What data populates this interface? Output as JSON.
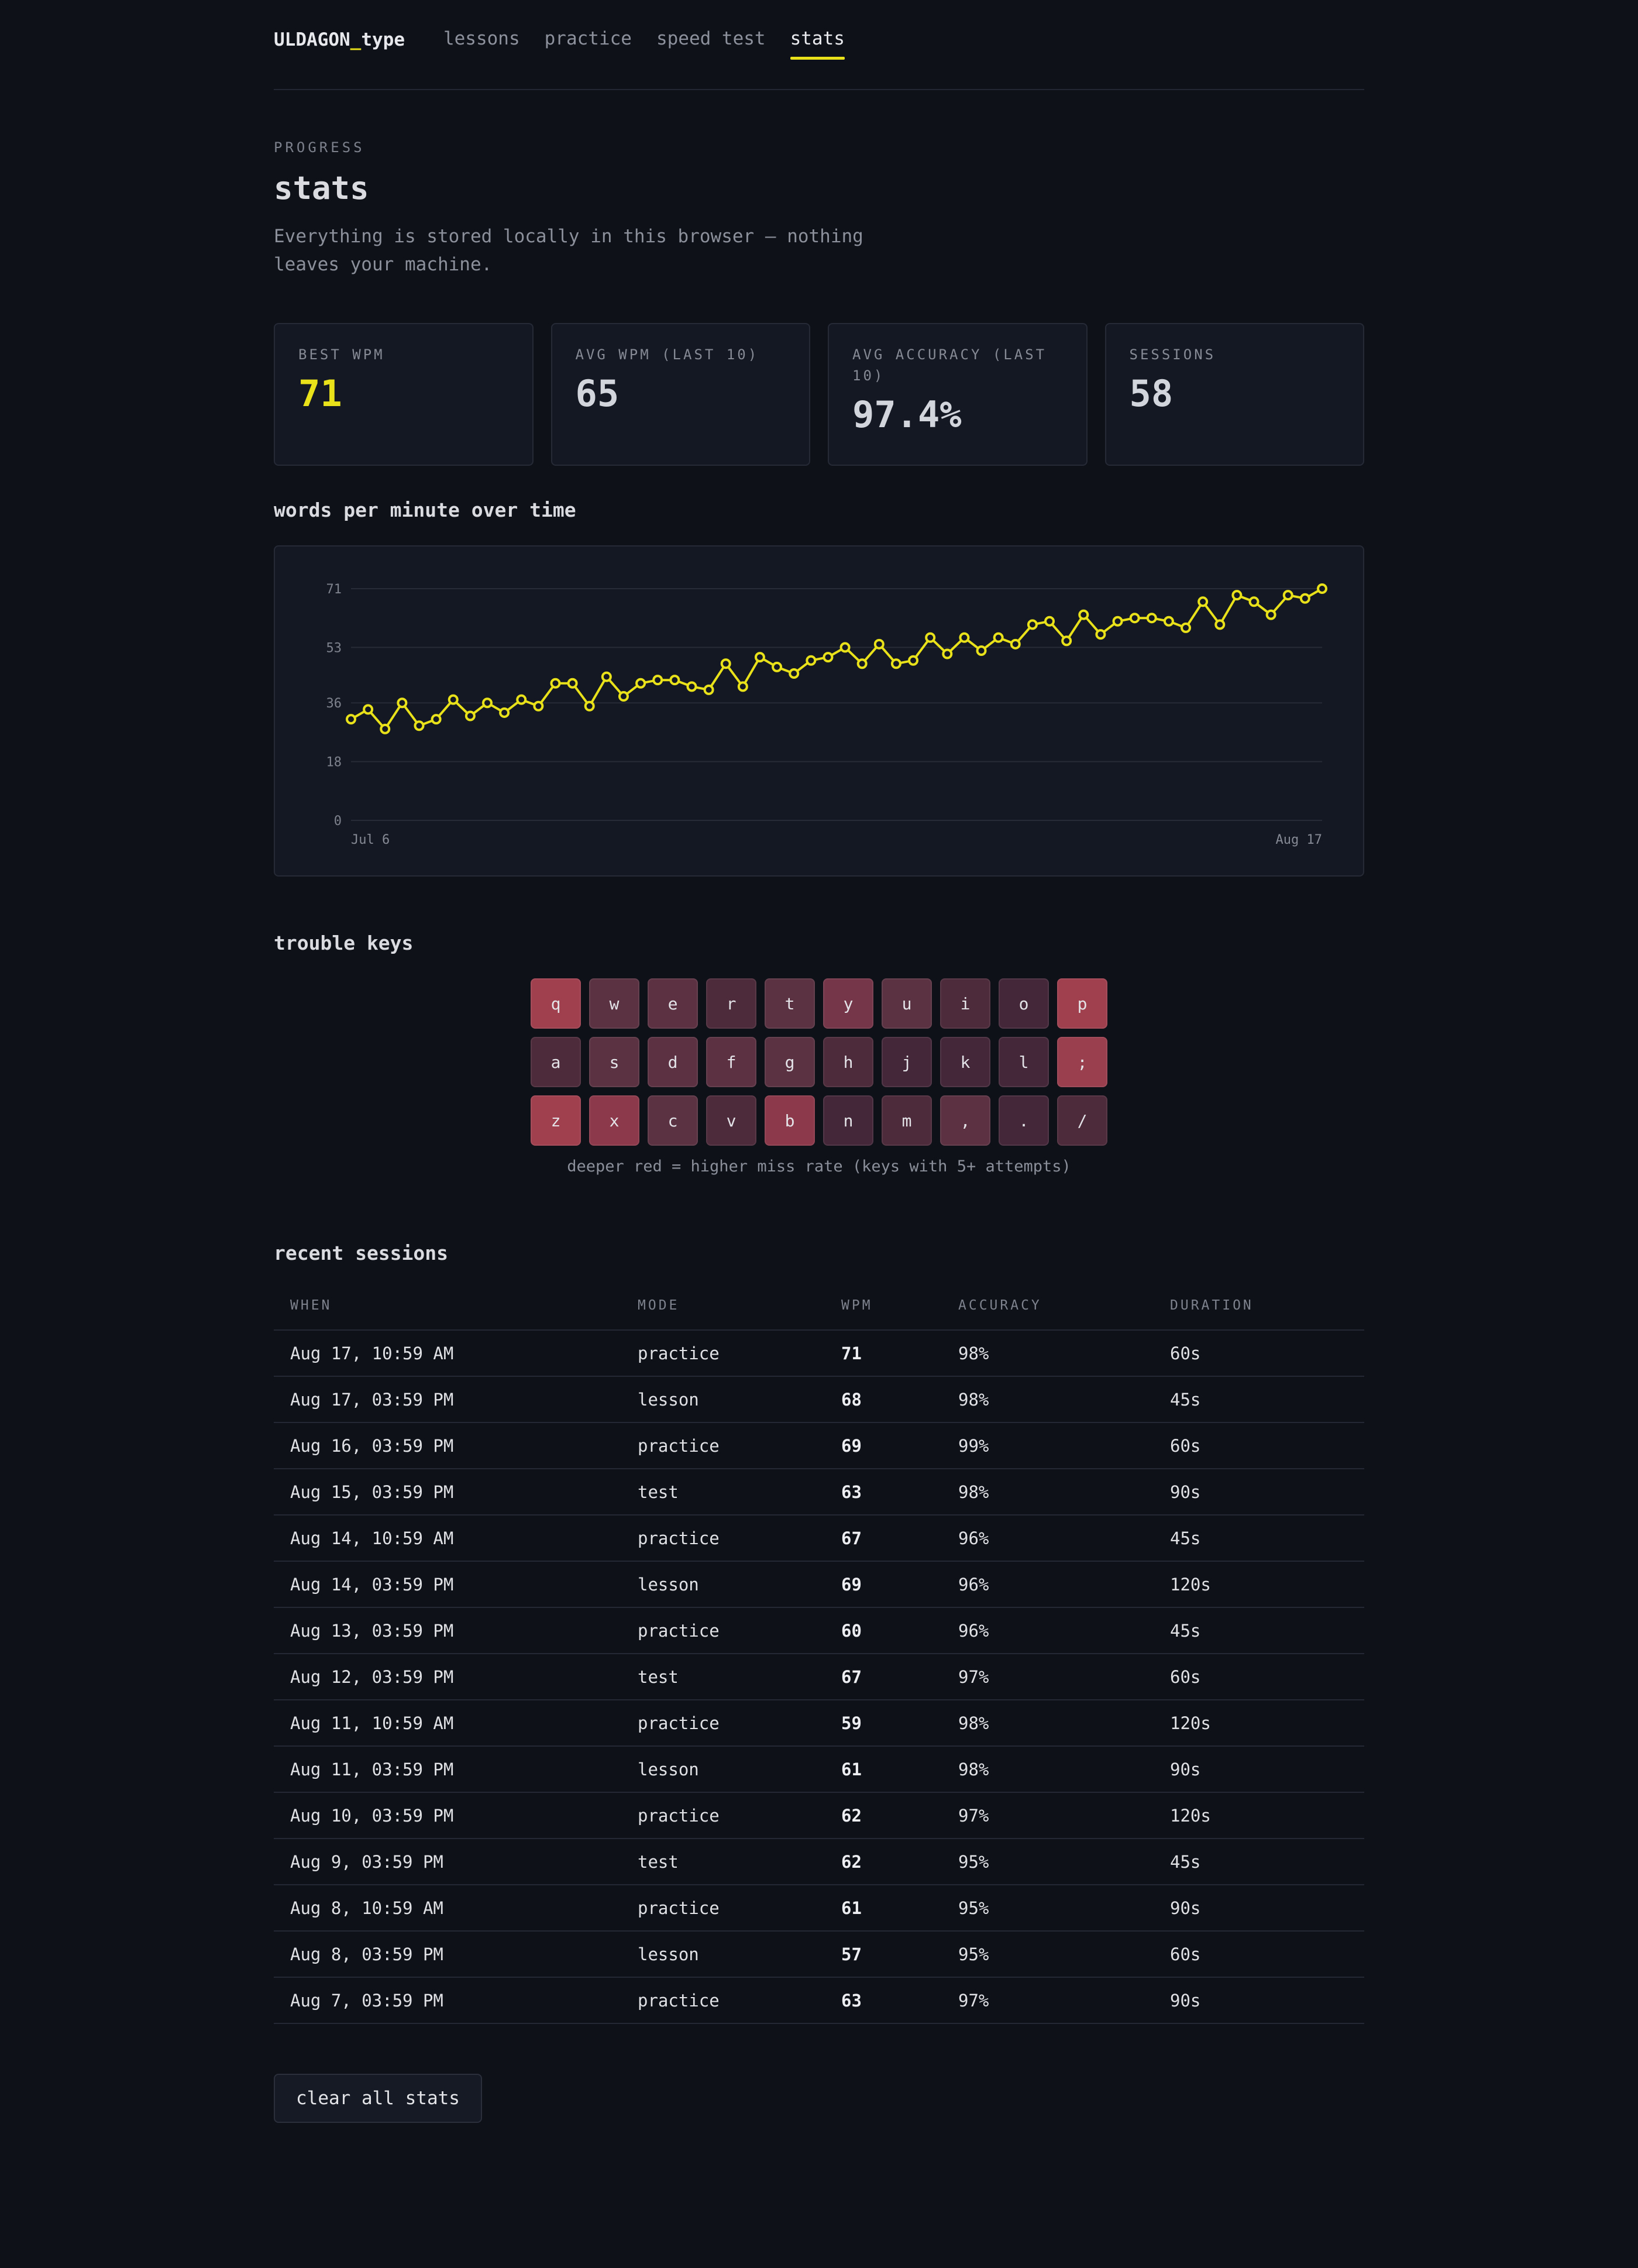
{
  "nav": {
    "brand_prefix": "ULDAGON",
    "brand_sep": "_",
    "brand_suffix": "type",
    "links": [
      {
        "label": "lessons",
        "active": false
      },
      {
        "label": "practice",
        "active": false
      },
      {
        "label": "speed test",
        "active": false
      },
      {
        "label": "stats",
        "active": true
      }
    ]
  },
  "header": {
    "eyebrow": "PROGRESS",
    "title": "stats",
    "description": "Everything is stored locally in this browser — nothing leaves your machine."
  },
  "cards": [
    {
      "label": "BEST WPM",
      "value": "71",
      "accent": true
    },
    {
      "label": "AVG WPM (LAST 10)",
      "value": "65",
      "accent": false
    },
    {
      "label": "AVG ACCURACY (LAST 10)",
      "value": "97.4%",
      "accent": false
    },
    {
      "label": "SESSIONS",
      "value": "58",
      "accent": false
    }
  ],
  "chart_section": {
    "title": "words per minute over time"
  },
  "chart_data": {
    "type": "line",
    "x_start_label": "Jul 6",
    "x_end_label": "Aug 17",
    "yticks": [
      0,
      18,
      36,
      53,
      71
    ],
    "ylim": [
      0,
      71
    ],
    "grid": true,
    "line_color": "#e9e21a",
    "values": [
      31,
      34,
      28,
      36,
      29,
      31,
      37,
      32,
      36,
      33,
      37,
      35,
      42,
      42,
      35,
      44,
      38,
      42,
      43,
      43,
      41,
      40,
      48,
      41,
      50,
      47,
      45,
      49,
      50,
      53,
      48,
      54,
      48,
      49,
      56,
      51,
      56,
      52,
      56,
      54,
      60,
      61,
      55,
      63,
      57,
      61,
      62,
      62,
      61,
      59,
      67,
      60,
      69,
      67,
      63,
      69,
      68,
      71
    ],
    "point_count": 58
  },
  "trouble_keys": {
    "title": "trouble keys",
    "note": "deeper red = higher miss rate (keys with 5+ attempts)",
    "rows": [
      [
        {
          "k": "q",
          "c": "#a0404f"
        },
        {
          "k": "w",
          "c": "#5a3242"
        },
        {
          "k": "e",
          "c": "#5c3243"
        },
        {
          "k": "r",
          "c": "#4d2b3a"
        },
        {
          "k": "t",
          "c": "#5a3242"
        },
        {
          "k": "y",
          "c": "#763649"
        },
        {
          "k": "u",
          "c": "#5a3242"
        },
        {
          "k": "i",
          "c": "#4d2b3a"
        },
        {
          "k": "o",
          "c": "#44283a"
        },
        {
          "k": "p",
          "c": "#a0404f"
        }
      ],
      [
        {
          "k": "a",
          "c": "#4d2b3a"
        },
        {
          "k": "s",
          "c": "#5a3242"
        },
        {
          "k": "d",
          "c": "#5c3243"
        },
        {
          "k": "f",
          "c": "#5c3243"
        },
        {
          "k": "g",
          "c": "#5a3242"
        },
        {
          "k": "h",
          "c": "#4d2b3a"
        },
        {
          "k": "j",
          "c": "#44283a"
        },
        {
          "k": "k",
          "c": "#44283a"
        },
        {
          "k": "l",
          "c": "#44283a"
        },
        {
          "k": ";",
          "c": "#9a3f4e"
        }
      ],
      [
        {
          "k": "z",
          "c": "#a0404f"
        },
        {
          "k": "x",
          "c": "#8c3a4b"
        },
        {
          "k": "c",
          "c": "#5a3242"
        },
        {
          "k": "v",
          "c": "#4d2b3a"
        },
        {
          "k": "b",
          "c": "#8c3a4b"
        },
        {
          "k": "n",
          "c": "#44283a"
        },
        {
          "k": "m",
          "c": "#4d2b3a"
        },
        {
          "k": ",",
          "c": "#5c3243"
        },
        {
          "k": ".",
          "c": "#44283a"
        },
        {
          "k": "/",
          "c": "#4d2b3a"
        }
      ]
    ]
  },
  "sessions": {
    "title": "recent sessions",
    "headers": [
      "WHEN",
      "MODE",
      "WPM",
      "ACCURACY",
      "DURATION"
    ],
    "rows": [
      [
        "Aug 17, 10:59 AM",
        "practice",
        "71",
        "98%",
        "60s"
      ],
      [
        "Aug 17, 03:59 PM",
        "lesson",
        "68",
        "98%",
        "45s"
      ],
      [
        "Aug 16, 03:59 PM",
        "practice",
        "69",
        "99%",
        "60s"
      ],
      [
        "Aug 15, 03:59 PM",
        "test",
        "63",
        "98%",
        "90s"
      ],
      [
        "Aug 14, 10:59 AM",
        "practice",
        "67",
        "96%",
        "45s"
      ],
      [
        "Aug 14, 03:59 PM",
        "lesson",
        "69",
        "96%",
        "120s"
      ],
      [
        "Aug 13, 03:59 PM",
        "practice",
        "60",
        "96%",
        "45s"
      ],
      [
        "Aug 12, 03:59 PM",
        "test",
        "67",
        "97%",
        "60s"
      ],
      [
        "Aug 11, 10:59 AM",
        "practice",
        "59",
        "98%",
        "120s"
      ],
      [
        "Aug 11, 03:59 PM",
        "lesson",
        "61",
        "98%",
        "90s"
      ],
      [
        "Aug 10, 03:59 PM",
        "practice",
        "62",
        "97%",
        "120s"
      ],
      [
        "Aug 9, 03:59 PM",
        "test",
        "62",
        "95%",
        "45s"
      ],
      [
        "Aug 8, 10:59 AM",
        "practice",
        "61",
        "95%",
        "90s"
      ],
      [
        "Aug 8, 03:59 PM",
        "lesson",
        "57",
        "95%",
        "60s"
      ],
      [
        "Aug 7, 03:59 PM",
        "practice",
        "63",
        "97%",
        "90s"
      ]
    ]
  },
  "actions": {
    "clear_label": "clear all stats"
  }
}
